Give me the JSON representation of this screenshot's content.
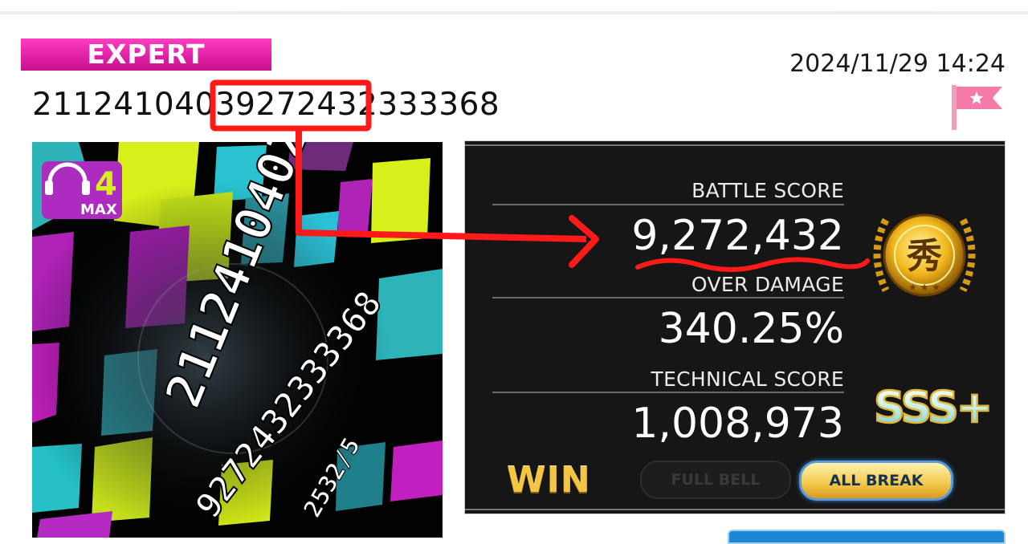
{
  "header": {
    "difficulty": "EXPERT",
    "song_title": "21124104039272432333368",
    "timestamp": "2024/11/29 14:24"
  },
  "jacket": {
    "logo_text": "MAX",
    "title_lines": [
      "211241040Z",
      "9272432333368",
      "2532/5"
    ]
  },
  "scores": {
    "battle_label": "BATTLE SCORE",
    "battle_value": "9,272,432",
    "over_damage_label": "OVER DAMAGE",
    "over_damage_value": "340.25%",
    "technical_label": "TECHNICAL SCORE",
    "technical_value": "1,008,973"
  },
  "result": {
    "outcome": "WIN",
    "full_bell": "FULL BELL",
    "all_break": "ALL BREAK"
  },
  "badges": {
    "platinum_medal": "秀",
    "rank": "SSS+"
  },
  "colors": {
    "difficulty_pink": "#e020a6",
    "panel_bg": "#161616",
    "annotation_red": "#ff1a1a",
    "gold": "#f2c542",
    "flag_pink": "#f47aa8"
  }
}
